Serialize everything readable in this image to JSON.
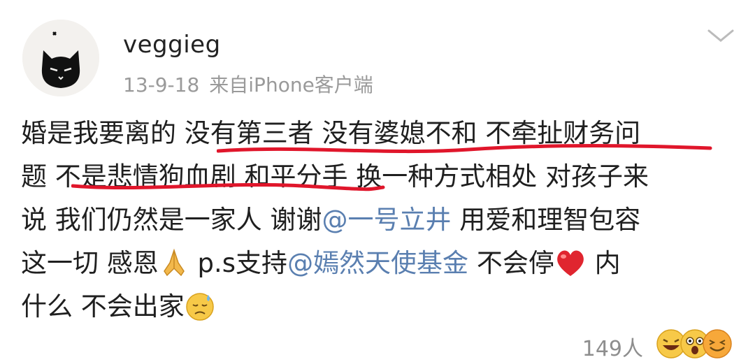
{
  "user": {
    "name": "veggieg",
    "date": "13-9-18",
    "source": "来自iPhone客户端"
  },
  "post": {
    "line1": {
      "a": "婚是我要离的 ",
      "b": "没有第三者 没有婆媳不和 不牵扯财务问"
    },
    "line2": {
      "a": "题 ",
      "b": "不是悲情狗血剧 和平分手",
      "c": " 换一种方式相处 对孩子来"
    },
    "line3": {
      "a": "说 我们仍然是一家人 谢谢",
      "mention": "@一号立井",
      "b": " 用爱和理智包容"
    },
    "line4": {
      "a": "这一切 感恩",
      "b": " p.s支持",
      "mention": "@嫣然天使基金",
      "c": " 不会停",
      "d": " 内"
    },
    "line5": {
      "a": "什么 不会出家"
    }
  },
  "icons": {
    "avatar": "black-cat-avatar",
    "menu": "chevron-down-icon",
    "pray": "praying-hands-emoji",
    "heart": "red-heart-emoji",
    "sweat": "downcast-sweat-emoji",
    "reactions": [
      "laughing-emoji",
      "surprised-emoji",
      "grinning-squint-emoji"
    ]
  },
  "colors": {
    "mention": "#5a7fb0",
    "underline": "#e0162b",
    "heart": "#e0252f"
  },
  "footer": {
    "likes": "149人"
  }
}
